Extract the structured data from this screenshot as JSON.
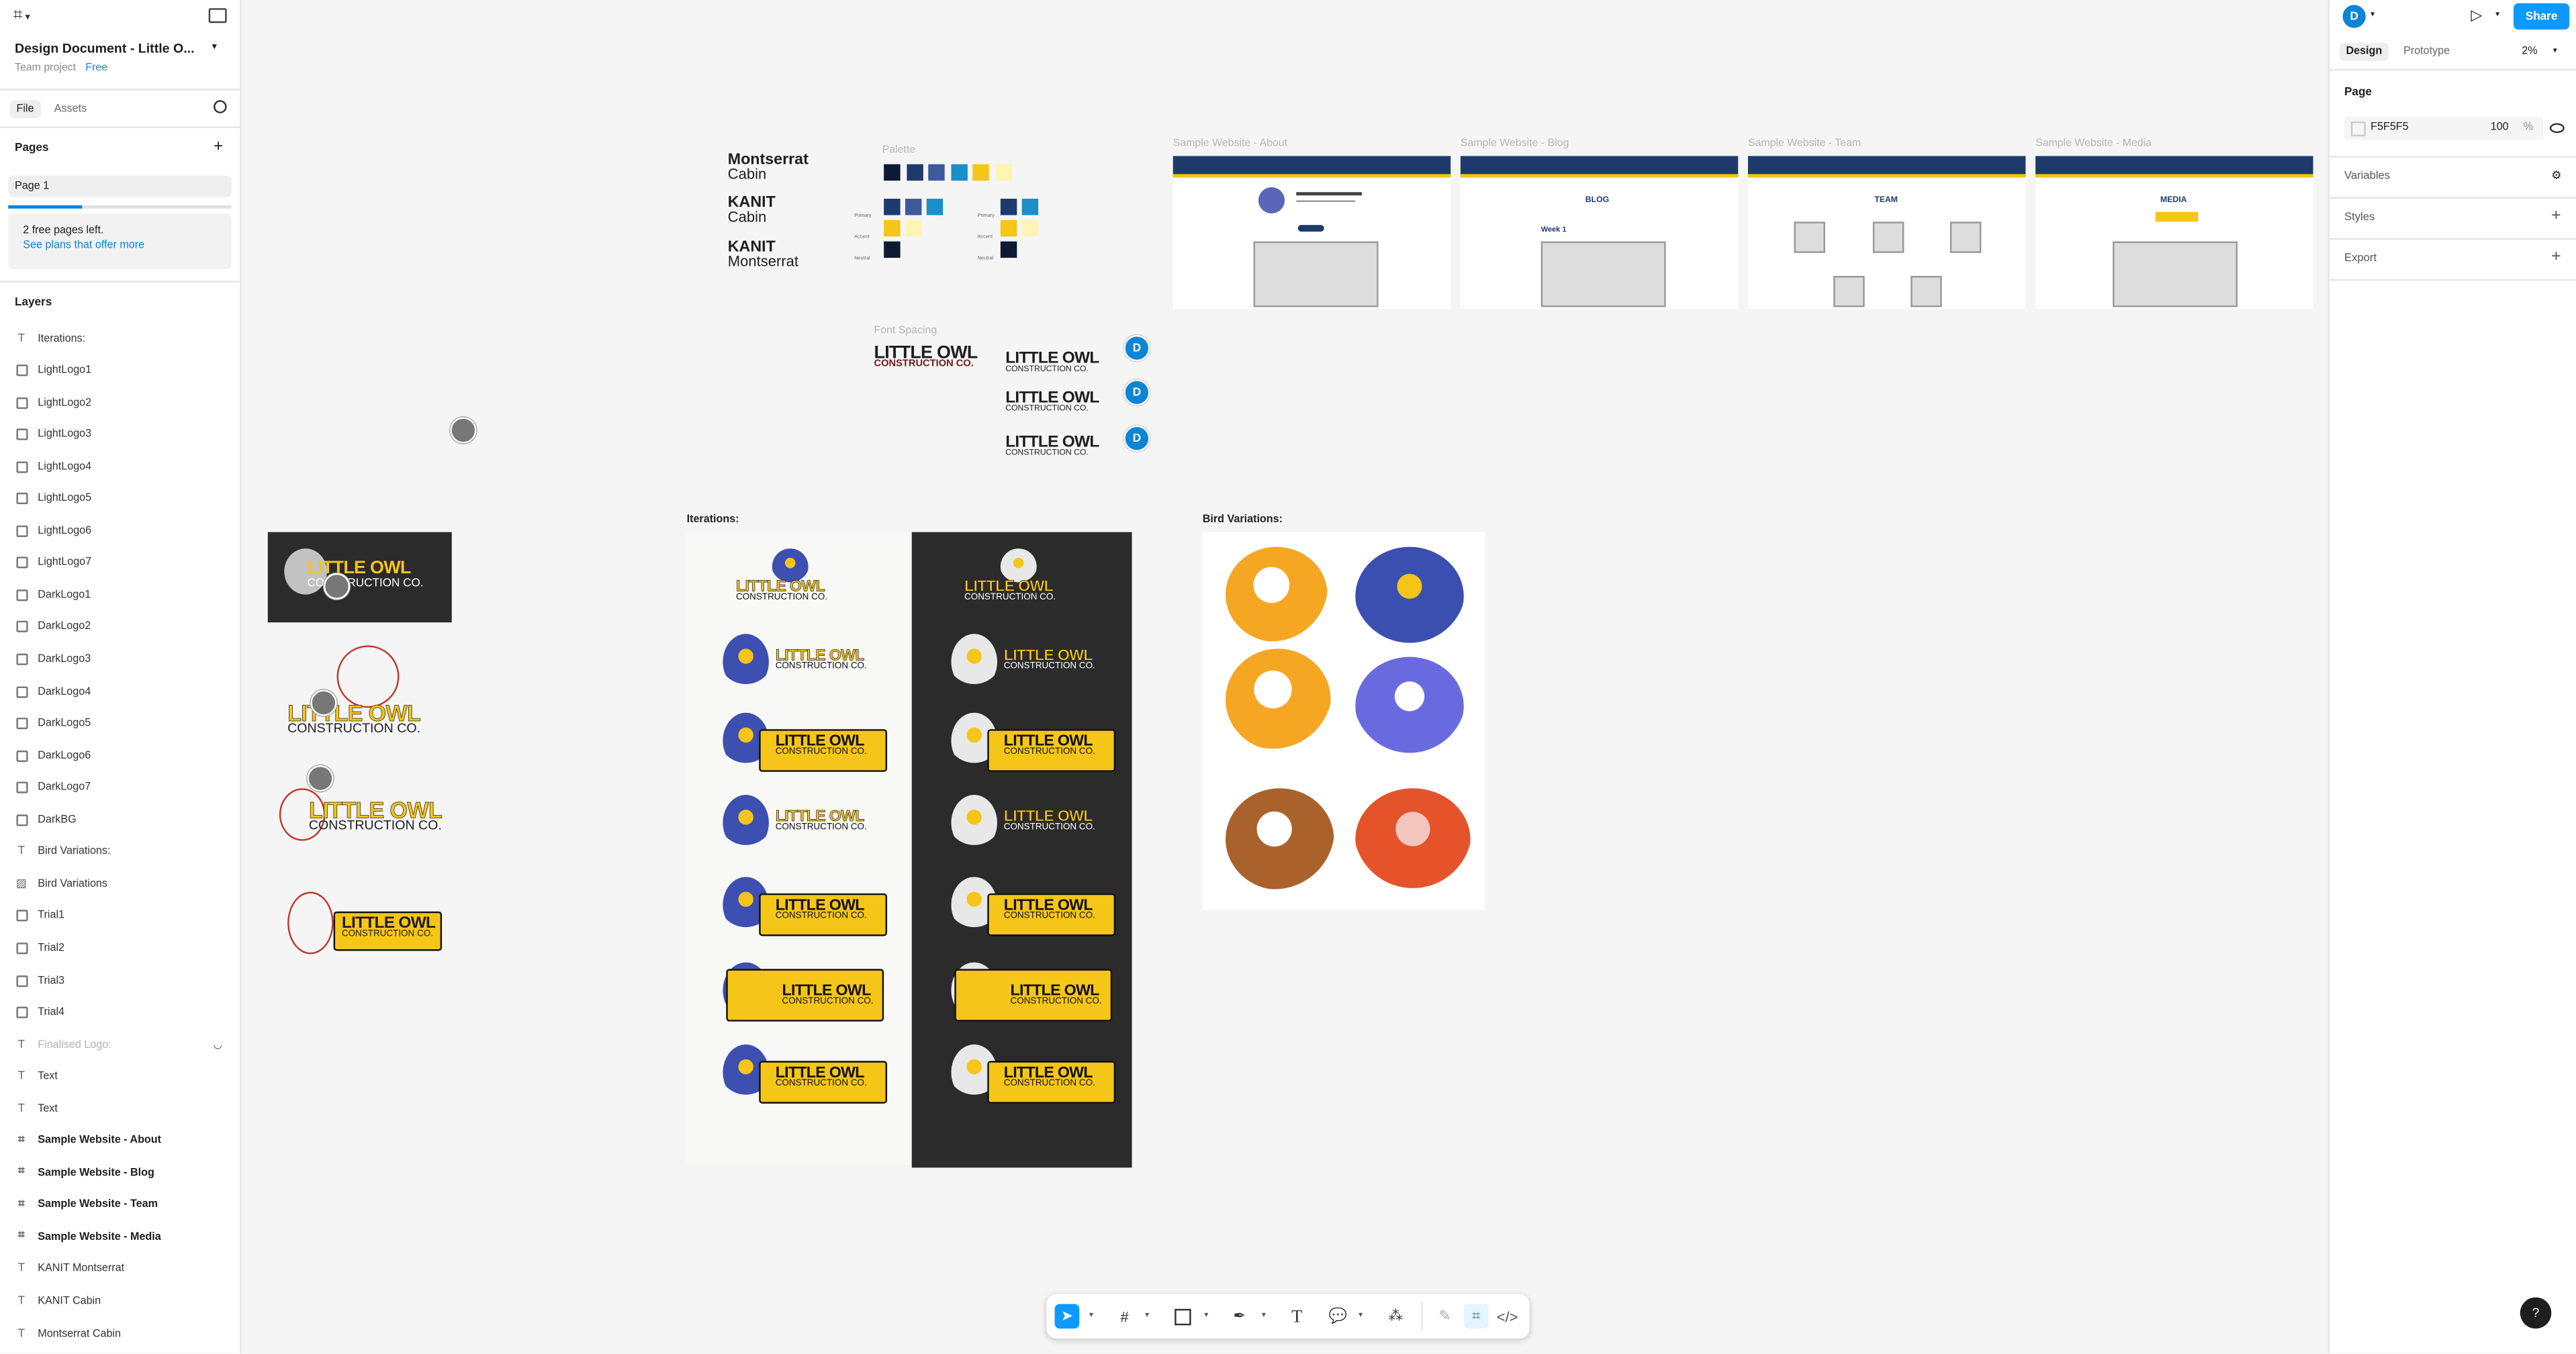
{
  "app": {
    "file_title": "Design Document - Little O...",
    "project": "Team project",
    "plan_badge": "Free",
    "tabs": [
      "File",
      "Assets"
    ],
    "pages_heading": "Pages",
    "pages": [
      "Page 1"
    ],
    "page_limit_text": "2 free pages left.",
    "page_limit_link": "See plans that offer more",
    "layers_heading": "Layers",
    "layers": [
      {
        "type": "text",
        "name": "Iterations:"
      },
      {
        "type": "rect",
        "name": "LightLogo1"
      },
      {
        "type": "rect",
        "name": "LightLogo2"
      },
      {
        "type": "rect",
        "name": "LightLogo3"
      },
      {
        "type": "rect",
        "name": "LightLogo4"
      },
      {
        "type": "rect",
        "name": "LightLogo5"
      },
      {
        "type": "rect",
        "name": "LightLogo6"
      },
      {
        "type": "rect",
        "name": "LightLogo7"
      },
      {
        "type": "rect",
        "name": "DarkLogo1"
      },
      {
        "type": "rect",
        "name": "DarkLogo2"
      },
      {
        "type": "rect",
        "name": "DarkLogo3"
      },
      {
        "type": "rect",
        "name": "DarkLogo4"
      },
      {
        "type": "rect",
        "name": "DarkLogo5"
      },
      {
        "type": "rect",
        "name": "DarkLogo6"
      },
      {
        "type": "rect",
        "name": "DarkLogo7"
      },
      {
        "type": "rect",
        "name": "DarkBG"
      },
      {
        "type": "text",
        "name": "Bird Variations:"
      },
      {
        "type": "image",
        "name": "Bird Variations"
      },
      {
        "type": "rect",
        "name": "Trial1"
      },
      {
        "type": "rect",
        "name": "Trial2"
      },
      {
        "type": "rect",
        "name": "Trial3"
      },
      {
        "type": "rect",
        "name": "Trial4"
      },
      {
        "type": "text",
        "name": "Finalised Logo:",
        "hidden": true
      },
      {
        "type": "text",
        "name": "Text"
      },
      {
        "type": "text",
        "name": "Text"
      },
      {
        "type": "frame",
        "name": "Sample Website - About"
      },
      {
        "type": "frame",
        "name": "Sample Website - Blog"
      },
      {
        "type": "frame",
        "name": "Sample Website - Team"
      },
      {
        "type": "frame",
        "name": "Sample Website - Media"
      },
      {
        "type": "text",
        "name": "KANIT Montserrat"
      },
      {
        "type": "text",
        "name": "KANIT Cabin"
      },
      {
        "type": "text",
        "name": "Montserrat Cabin"
      }
    ]
  },
  "right_panel": {
    "user_initial": "D",
    "share_label": "Share",
    "tabs": [
      "Design",
      "Prototype"
    ],
    "zoom": "2%",
    "page_heading": "Page",
    "bg_color_hex": "F5F5F5",
    "bg_opacity": "100",
    "opacity_unit": "%",
    "sections": [
      "Variables",
      "Styles",
      "Export"
    ]
  },
  "canvas": {
    "fonts": [
      {
        "line1": "Montserrat",
        "line2": "Cabin"
      },
      {
        "line1": "KANIT",
        "line2": "Cabin"
      },
      {
        "line1": "KANIT",
        "line2": "Montserrat"
      }
    ],
    "palette_label": "Palette",
    "palette_colors": [
      "#0c1a33",
      "#1e3a6d",
      "#3d5a9e",
      "#1a8fc8",
      "#f5c518",
      "#fff4b3"
    ],
    "palette_rows": [
      "Primary",
      "Accent",
      "Neutral"
    ],
    "font_spacing_label": "Font Spacing",
    "brand_top": "LITTLE OWL",
    "brand_bottom": "CONSTRUCTION CO.",
    "collaborator_initial": "D",
    "websites": [
      {
        "label": "Sample Website - About",
        "heading": ""
      },
      {
        "label": "Sample Website - Blog",
        "heading": "BLOG",
        "sub": "Week 1"
      },
      {
        "label": "Sample Website - Team",
        "heading": "TEAM"
      },
      {
        "label": "Sample Website - Media",
        "heading": "MEDIA"
      }
    ],
    "iterations_label": "Iterations:",
    "bird_variations_label": "Bird Variations:"
  },
  "toolbar": {
    "tools": [
      "move-tool",
      "frame-tool",
      "shape-tool",
      "pen-tool",
      "text-tool",
      "comment-tool",
      "actions-tool",
      "draw-mode",
      "design-mode",
      "dev-mode"
    ]
  },
  "help_label": "?"
}
